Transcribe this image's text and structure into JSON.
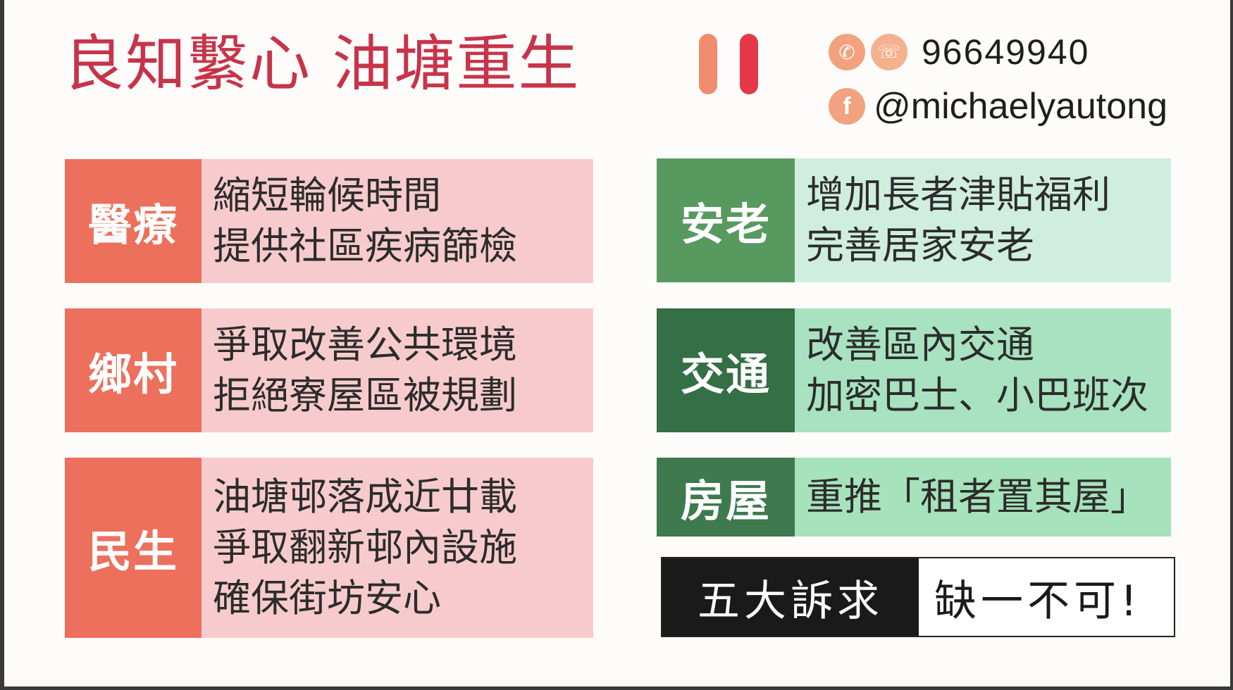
{
  "title": "良知繫心 油塘重生",
  "contact": {
    "phone": "96649940",
    "facebook": "@michaelyautong"
  },
  "icons": {
    "phone": "phone-icon",
    "whatsapp": "whatsapp-icon",
    "facebook": "facebook-icon"
  },
  "colors": {
    "title": "#c7344a",
    "bar_left": "#ef8c6e",
    "bar_right": "#e4384a",
    "tag_red": "#ec705c",
    "desc_red": "#f7cbcd",
    "tag_green": "#58995f",
    "tag_dark_green": "#356f45"
  },
  "pledges_left": [
    {
      "tag": "醫療",
      "lines": [
        "縮短輪候時間",
        "提供社區疾病篩檢"
      ]
    },
    {
      "tag": "鄉村",
      "lines": [
        "爭取改善公共環境",
        "拒絕寮屋區被規劃"
      ]
    },
    {
      "tag": "民生",
      "lines": [
        "油塘邨落成近廿載",
        "爭取翻新邨內設施",
        "確保街坊安心"
      ]
    }
  ],
  "pledges_right": [
    {
      "tag": "安老",
      "lines": [
        "增加長者津貼福利",
        "完善居家安老"
      ]
    },
    {
      "tag": "交通",
      "lines": [
        "改善區內交通",
        "加密巴士、小巴班次"
      ]
    },
    {
      "tag": "房屋",
      "lines": [
        "重推「租者置其屋」"
      ]
    }
  ],
  "slogan": {
    "left": "五大訴求",
    "right": "缺一不可!"
  }
}
